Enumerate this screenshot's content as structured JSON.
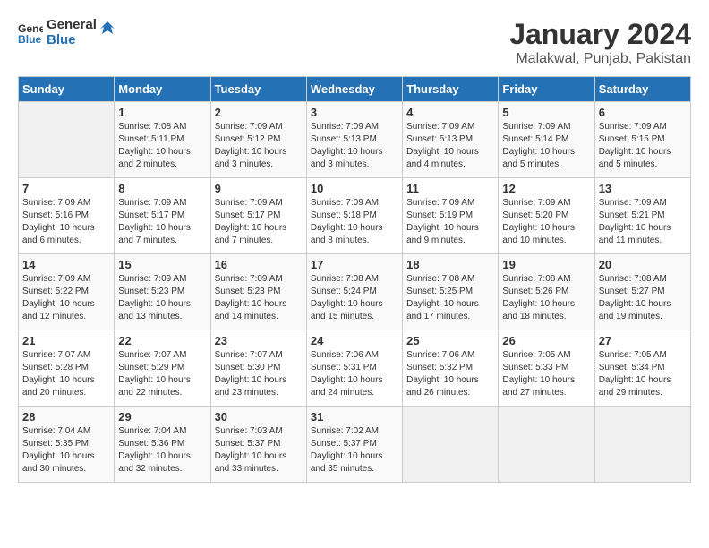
{
  "header": {
    "logo_line1": "General",
    "logo_line2": "Blue",
    "title": "January 2024",
    "subtitle": "Malakwal, Punjab, Pakistan"
  },
  "days_of_week": [
    "Sunday",
    "Monday",
    "Tuesday",
    "Wednesday",
    "Thursday",
    "Friday",
    "Saturday"
  ],
  "weeks": [
    [
      {
        "day": "",
        "sunrise": "",
        "sunset": "",
        "daylight": ""
      },
      {
        "day": "1",
        "sunrise": "Sunrise: 7:08 AM",
        "sunset": "Sunset: 5:11 PM",
        "daylight": "Daylight: 10 hours and 2 minutes."
      },
      {
        "day": "2",
        "sunrise": "Sunrise: 7:09 AM",
        "sunset": "Sunset: 5:12 PM",
        "daylight": "Daylight: 10 hours and 3 minutes."
      },
      {
        "day": "3",
        "sunrise": "Sunrise: 7:09 AM",
        "sunset": "Sunset: 5:13 PM",
        "daylight": "Daylight: 10 hours and 3 minutes."
      },
      {
        "day": "4",
        "sunrise": "Sunrise: 7:09 AM",
        "sunset": "Sunset: 5:13 PM",
        "daylight": "Daylight: 10 hours and 4 minutes."
      },
      {
        "day": "5",
        "sunrise": "Sunrise: 7:09 AM",
        "sunset": "Sunset: 5:14 PM",
        "daylight": "Daylight: 10 hours and 5 minutes."
      },
      {
        "day": "6",
        "sunrise": "Sunrise: 7:09 AM",
        "sunset": "Sunset: 5:15 PM",
        "daylight": "Daylight: 10 hours and 5 minutes."
      }
    ],
    [
      {
        "day": "7",
        "sunrise": "Sunrise: 7:09 AM",
        "sunset": "Sunset: 5:16 PM",
        "daylight": "Daylight: 10 hours and 6 minutes."
      },
      {
        "day": "8",
        "sunrise": "Sunrise: 7:09 AM",
        "sunset": "Sunset: 5:17 PM",
        "daylight": "Daylight: 10 hours and 7 minutes."
      },
      {
        "day": "9",
        "sunrise": "Sunrise: 7:09 AM",
        "sunset": "Sunset: 5:17 PM",
        "daylight": "Daylight: 10 hours and 7 minutes."
      },
      {
        "day": "10",
        "sunrise": "Sunrise: 7:09 AM",
        "sunset": "Sunset: 5:18 PM",
        "daylight": "Daylight: 10 hours and 8 minutes."
      },
      {
        "day": "11",
        "sunrise": "Sunrise: 7:09 AM",
        "sunset": "Sunset: 5:19 PM",
        "daylight": "Daylight: 10 hours and 9 minutes."
      },
      {
        "day": "12",
        "sunrise": "Sunrise: 7:09 AM",
        "sunset": "Sunset: 5:20 PM",
        "daylight": "Daylight: 10 hours and 10 minutes."
      },
      {
        "day": "13",
        "sunrise": "Sunrise: 7:09 AM",
        "sunset": "Sunset: 5:21 PM",
        "daylight": "Daylight: 10 hours and 11 minutes."
      }
    ],
    [
      {
        "day": "14",
        "sunrise": "Sunrise: 7:09 AM",
        "sunset": "Sunset: 5:22 PM",
        "daylight": "Daylight: 10 hours and 12 minutes."
      },
      {
        "day": "15",
        "sunrise": "Sunrise: 7:09 AM",
        "sunset": "Sunset: 5:23 PM",
        "daylight": "Daylight: 10 hours and 13 minutes."
      },
      {
        "day": "16",
        "sunrise": "Sunrise: 7:09 AM",
        "sunset": "Sunset: 5:23 PM",
        "daylight": "Daylight: 10 hours and 14 minutes."
      },
      {
        "day": "17",
        "sunrise": "Sunrise: 7:08 AM",
        "sunset": "Sunset: 5:24 PM",
        "daylight": "Daylight: 10 hours and 15 minutes."
      },
      {
        "day": "18",
        "sunrise": "Sunrise: 7:08 AM",
        "sunset": "Sunset: 5:25 PM",
        "daylight": "Daylight: 10 hours and 17 minutes."
      },
      {
        "day": "19",
        "sunrise": "Sunrise: 7:08 AM",
        "sunset": "Sunset: 5:26 PM",
        "daylight": "Daylight: 10 hours and 18 minutes."
      },
      {
        "day": "20",
        "sunrise": "Sunrise: 7:08 AM",
        "sunset": "Sunset: 5:27 PM",
        "daylight": "Daylight: 10 hours and 19 minutes."
      }
    ],
    [
      {
        "day": "21",
        "sunrise": "Sunrise: 7:07 AM",
        "sunset": "Sunset: 5:28 PM",
        "daylight": "Daylight: 10 hours and 20 minutes."
      },
      {
        "day": "22",
        "sunrise": "Sunrise: 7:07 AM",
        "sunset": "Sunset: 5:29 PM",
        "daylight": "Daylight: 10 hours and 22 minutes."
      },
      {
        "day": "23",
        "sunrise": "Sunrise: 7:07 AM",
        "sunset": "Sunset: 5:30 PM",
        "daylight": "Daylight: 10 hours and 23 minutes."
      },
      {
        "day": "24",
        "sunrise": "Sunrise: 7:06 AM",
        "sunset": "Sunset: 5:31 PM",
        "daylight": "Daylight: 10 hours and 24 minutes."
      },
      {
        "day": "25",
        "sunrise": "Sunrise: 7:06 AM",
        "sunset": "Sunset: 5:32 PM",
        "daylight": "Daylight: 10 hours and 26 minutes."
      },
      {
        "day": "26",
        "sunrise": "Sunrise: 7:05 AM",
        "sunset": "Sunset: 5:33 PM",
        "daylight": "Daylight: 10 hours and 27 minutes."
      },
      {
        "day": "27",
        "sunrise": "Sunrise: 7:05 AM",
        "sunset": "Sunset: 5:34 PM",
        "daylight": "Daylight: 10 hours and 29 minutes."
      }
    ],
    [
      {
        "day": "28",
        "sunrise": "Sunrise: 7:04 AM",
        "sunset": "Sunset: 5:35 PM",
        "daylight": "Daylight: 10 hours and 30 minutes."
      },
      {
        "day": "29",
        "sunrise": "Sunrise: 7:04 AM",
        "sunset": "Sunset: 5:36 PM",
        "daylight": "Daylight: 10 hours and 32 minutes."
      },
      {
        "day": "30",
        "sunrise": "Sunrise: 7:03 AM",
        "sunset": "Sunset: 5:37 PM",
        "daylight": "Daylight: 10 hours and 33 minutes."
      },
      {
        "day": "31",
        "sunrise": "Sunrise: 7:02 AM",
        "sunset": "Sunset: 5:37 PM",
        "daylight": "Daylight: 10 hours and 35 minutes."
      },
      {
        "day": "",
        "sunrise": "",
        "sunset": "",
        "daylight": ""
      },
      {
        "day": "",
        "sunrise": "",
        "sunset": "",
        "daylight": ""
      },
      {
        "day": "",
        "sunrise": "",
        "sunset": "",
        "daylight": ""
      }
    ]
  ]
}
